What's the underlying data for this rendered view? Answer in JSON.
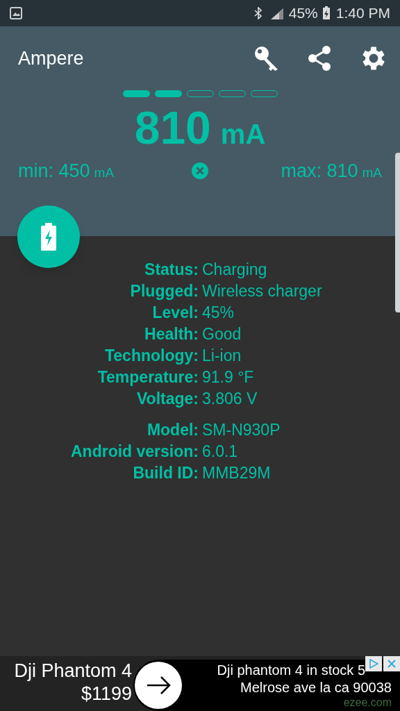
{
  "status_bar": {
    "battery": "45%",
    "time": "1:40 PM"
  },
  "app_bar": {
    "title": "Ampere"
  },
  "meter": {
    "segments": [
      {
        "filled": true
      },
      {
        "filled": true
      },
      {
        "filled": false
      },
      {
        "filled": false
      },
      {
        "filled": false
      }
    ],
    "value": "810",
    "unit": "mA",
    "min_label": "min: 450",
    "min_unit": "mA",
    "max_label": "max: 810",
    "max_unit": "mA"
  },
  "info_groups": [
    [
      {
        "label": "Status:",
        "value": "Charging"
      },
      {
        "label": "Plugged:",
        "value": "Wireless charger"
      },
      {
        "label": "Level:",
        "value": "45%"
      },
      {
        "label": "Health:",
        "value": "Good"
      },
      {
        "label": "Technology:",
        "value": "Li-ion"
      },
      {
        "label": "Temperature:",
        "value": "91.9 °F"
      },
      {
        "label": "Voltage:",
        "value": "3.806 V"
      }
    ],
    [
      {
        "label": "Model:",
        "value": "SM-N930P"
      },
      {
        "label": "Android version:",
        "value": "6.0.1"
      },
      {
        "label": "Build ID:",
        "value": "MMB29M"
      }
    ]
  ],
  "ad": {
    "title": "Dji Phantom 4",
    "price": "$1199",
    "line_1": "Dji phantom 4 in stock 5",
    "line_2": "Melrose ave la ca 90038",
    "domain": "ezee.com"
  }
}
